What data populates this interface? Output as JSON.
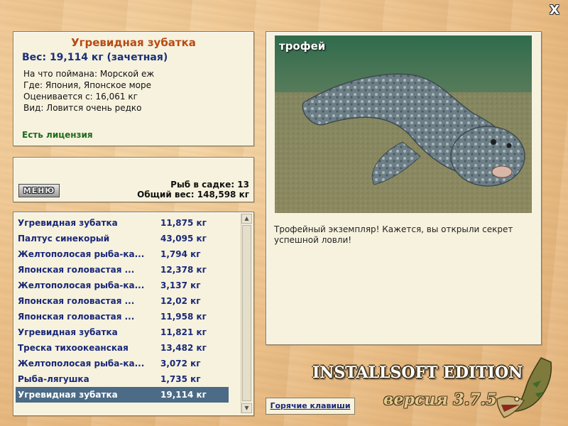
{
  "window": {
    "close_glyph": "X"
  },
  "info": {
    "title": "Угревидная зубатка",
    "weight": "Вес: 19,114 кг (зачетная)",
    "bait": "На что поймана: Морской еж",
    "location": "Где: Япония, Японское море",
    "valued_from": "Оценивается с: 16,061 кг",
    "rarity": "Вид: Ловится очень редко",
    "license": "Есть лицензия"
  },
  "catch": {
    "menu_label": "МЕНЮ",
    "fish_count": "Рыб в садке: 13",
    "total_weight": "Общий вес: 148,598 кг"
  },
  "fish_list": [
    {
      "name": "Угревидная зубатка",
      "weight": "11,875 кг"
    },
    {
      "name": "Палтус синекорый",
      "weight": "43,095 кг"
    },
    {
      "name": "Желтополосая рыба-ка...",
      "weight": "1,794 кг"
    },
    {
      "name": "Японская головастая ...",
      "weight": "12,378 кг"
    },
    {
      "name": "Желтополосая рыба-ка...",
      "weight": "3,137 кг"
    },
    {
      "name": "Японская головастая ...",
      "weight": "12,02 кг"
    },
    {
      "name": "Японская головастая ...",
      "weight": "11,958 кг"
    },
    {
      "name": "Угревидная зубатка",
      "weight": "11,821 кг"
    },
    {
      "name": "Треска тихоокеанская",
      "weight": "13,482 кг"
    },
    {
      "name": "Желтополосая рыба-ка...",
      "weight": "3,072 кг"
    },
    {
      "name": "Рыба-лягушка",
      "weight": "1,735 кг"
    },
    {
      "name": "Угревидная зубатка",
      "weight": "19,114 кг"
    }
  ],
  "selected_index": 11,
  "trophy": {
    "label": "трофей",
    "text": "Трофейный экземпляр! Кажется, вы открыли секрет успешной ловли!"
  },
  "footer": {
    "hotkeys": "Горячие клавиши",
    "brand": "INSTALLSOFT EDITION",
    "version": "версия 3.7.5"
  },
  "icons": {
    "close": "close-icon",
    "scroll_up": "chevron-up-icon",
    "scroll_down": "chevron-down-icon",
    "logo": "pike-fish-logo"
  },
  "colors": {
    "title": "#b84a14",
    "text_blue": "#1a2878",
    "license_green": "#1f6b1f",
    "selected_row": "#4b6b86",
    "panel_bg": "#f6f2de"
  }
}
